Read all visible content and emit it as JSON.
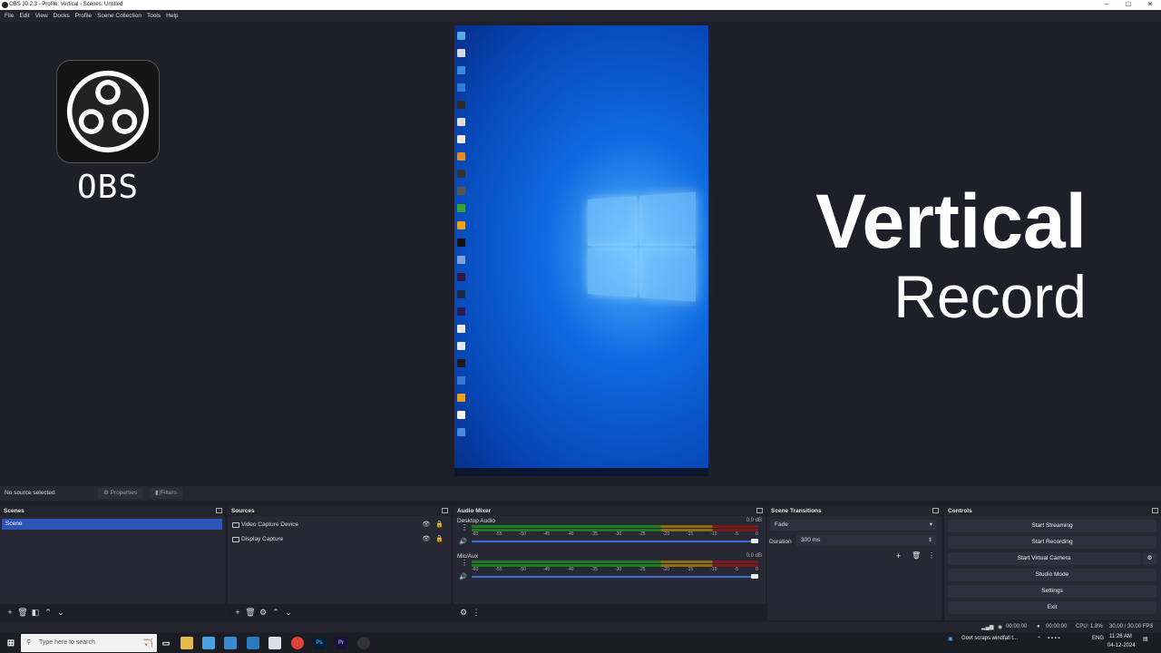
{
  "window": {
    "title": "OBS 30.2.3 - Profile: Vertical - Scenes: Untitled"
  },
  "menu": [
    "File",
    "Edit",
    "View",
    "Docks",
    "Profile",
    "Scene Collection",
    "Tools",
    "Help"
  ],
  "overlay": {
    "logo_text": "OBS",
    "headline": "Vertical",
    "subheadline": "Record"
  },
  "context_bar": {
    "no_source": "No source selected",
    "properties": "Properties",
    "filters": "Filters"
  },
  "scenes": {
    "title": "Scenes",
    "items": [
      "Scene"
    ]
  },
  "sources": {
    "title": "Sources",
    "items": [
      "Video Capture Device",
      "Display Capture"
    ]
  },
  "mixer": {
    "title": "Audio Mixer",
    "channels": [
      {
        "name": "Desktop Audio",
        "db": "0.0 dB"
      },
      {
        "name": "Mic/Aux",
        "db": "0.0 dB"
      }
    ],
    "ticks": [
      "-60",
      "-55",
      "-50",
      "-45",
      "-40",
      "-35",
      "-30",
      "-25",
      "-20",
      "-15",
      "-10",
      "-5",
      "0"
    ]
  },
  "transitions": {
    "title": "Scene Transitions",
    "type": "Fade",
    "duration_label": "Duration",
    "duration": "300 ms"
  },
  "controls": {
    "title": "Controls",
    "start_streaming": "Start Streaming",
    "start_recording": "Start Recording",
    "start_virtual_camera": "Start Virtual Camera",
    "studio_mode": "Studio Mode",
    "settings": "Settings",
    "exit": "Exit"
  },
  "status": {
    "stream_time": "00:00:00",
    "rec_time": "00:00:00",
    "cpu": "CPU: 1.8%",
    "fps": "30.00 / 30.00 FPS"
  },
  "taskbar": {
    "search_placeholder": "Type here to search",
    "news": "Govt scraps windfall t...",
    "lang": "ENG",
    "time": "11:26 AM",
    "date": "04-12-2024"
  }
}
